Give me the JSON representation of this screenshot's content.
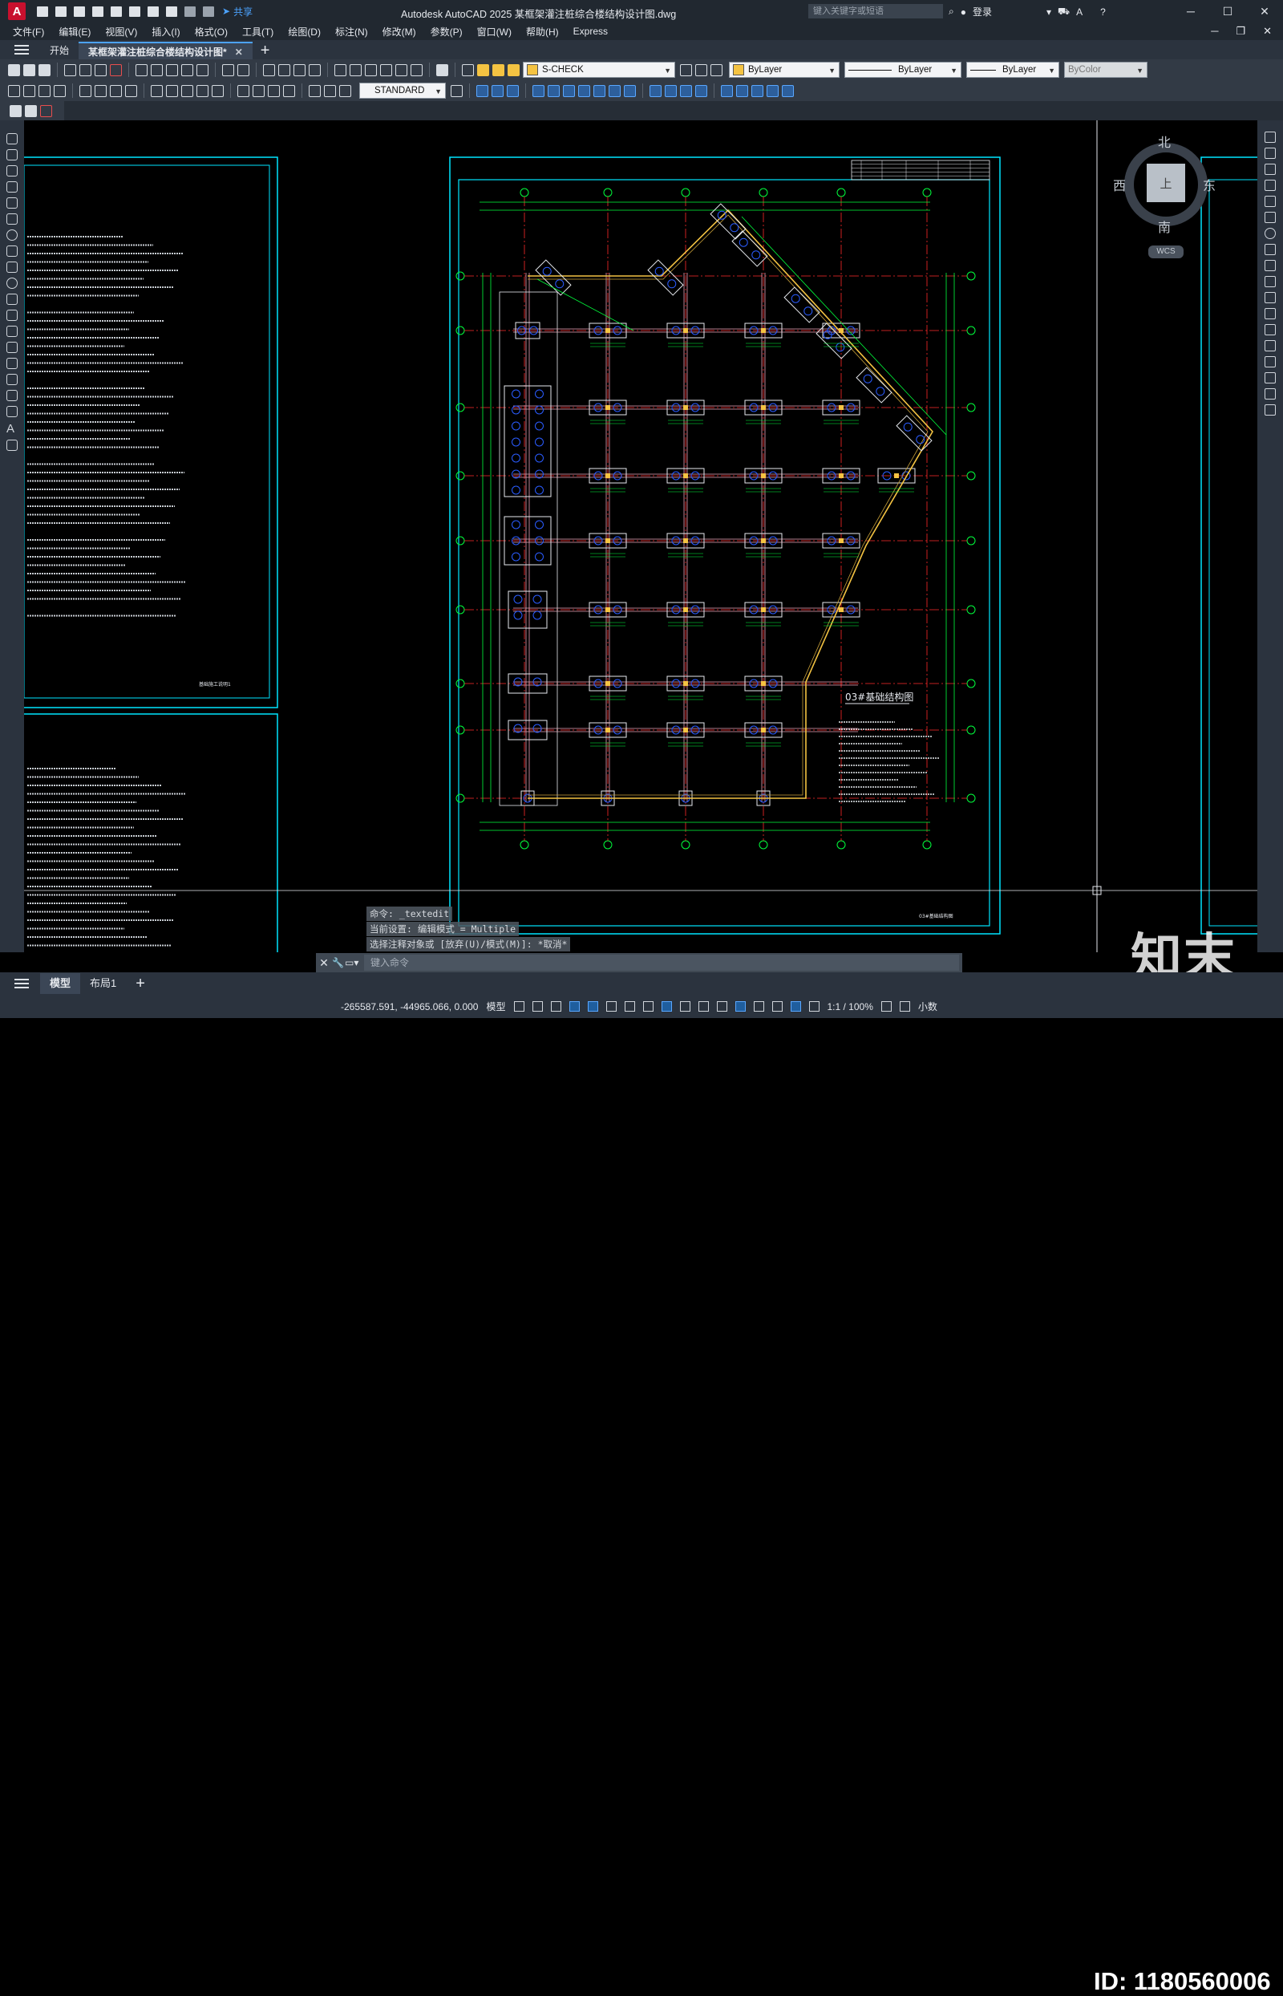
{
  "window": {
    "title": "Autodesk AutoCAD 2025    某框架灌注桩综合楼结构设计图.dwg",
    "share_label": "共享",
    "search_placeholder": "键入关键字或短语",
    "login_label": "登录",
    "app_letter": "A"
  },
  "menu": [
    "文件(F)",
    "编辑(E)",
    "视图(V)",
    "插入(I)",
    "格式(O)",
    "工具(T)",
    "绘图(D)",
    "标注(N)",
    "修改(M)",
    "参数(P)",
    "窗口(W)",
    "帮助(H)",
    "Express"
  ],
  "file_tabs": {
    "start": "开始",
    "active": "某框架灌注桩综合楼结构设计图*"
  },
  "toolbar": {
    "layer": "S-CHECK",
    "color": "ByLayer",
    "linetype": "ByLayer",
    "lineweight": "ByLayer",
    "plotstyle": "ByColor",
    "text_style": "STANDARD"
  },
  "viewcube": {
    "north": "北",
    "south": "南",
    "west": "西",
    "east": "东",
    "face": "上",
    "wcs": "WCS"
  },
  "drawing": {
    "title": "03#基础结构图",
    "left_footer": "基础施工说明1",
    "right_footer": "03#基础结构图"
  },
  "command": {
    "history": [
      "命令: _textedit",
      "当前设置: 编辑模式 = Multiple",
      "选择注释对象或 [放弃(U)/模式(M)]: *取消*"
    ],
    "placeholder": "键入命令"
  },
  "layout_tabs": [
    "模型",
    "布局1"
  ],
  "status": {
    "coords": "-265587.591, -44965.066, 0.000",
    "model": "模型",
    "scale": "1:1 / 100%",
    "units": "小数"
  },
  "watermark": {
    "logo": "知末",
    "id": "ID: 1180560006"
  }
}
